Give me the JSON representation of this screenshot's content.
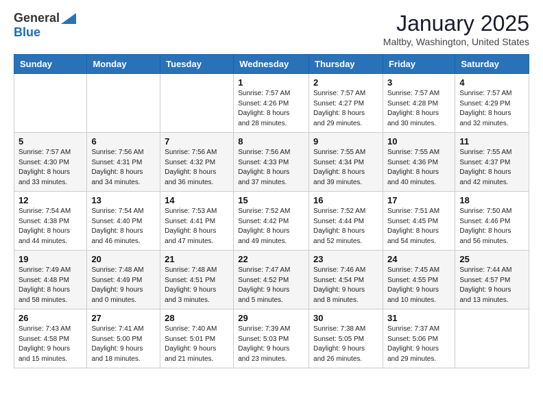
{
  "logo": {
    "general": "General",
    "blue": "Blue"
  },
  "header": {
    "month": "January 2025",
    "location": "Maltby, Washington, United States"
  },
  "weekdays": [
    "Sunday",
    "Monday",
    "Tuesday",
    "Wednesday",
    "Thursday",
    "Friday",
    "Saturday"
  ],
  "weeks": [
    [
      {
        "day": "",
        "info": ""
      },
      {
        "day": "",
        "info": ""
      },
      {
        "day": "",
        "info": ""
      },
      {
        "day": "1",
        "info": "Sunrise: 7:57 AM\nSunset: 4:26 PM\nDaylight: 8 hours\nand 28 minutes."
      },
      {
        "day": "2",
        "info": "Sunrise: 7:57 AM\nSunset: 4:27 PM\nDaylight: 8 hours\nand 29 minutes."
      },
      {
        "day": "3",
        "info": "Sunrise: 7:57 AM\nSunset: 4:28 PM\nDaylight: 8 hours\nand 30 minutes."
      },
      {
        "day": "4",
        "info": "Sunrise: 7:57 AM\nSunset: 4:29 PM\nDaylight: 8 hours\nand 32 minutes."
      }
    ],
    [
      {
        "day": "5",
        "info": "Sunrise: 7:57 AM\nSunset: 4:30 PM\nDaylight: 8 hours\nand 33 minutes."
      },
      {
        "day": "6",
        "info": "Sunrise: 7:56 AM\nSunset: 4:31 PM\nDaylight: 8 hours\nand 34 minutes."
      },
      {
        "day": "7",
        "info": "Sunrise: 7:56 AM\nSunset: 4:32 PM\nDaylight: 8 hours\nand 36 minutes."
      },
      {
        "day": "8",
        "info": "Sunrise: 7:56 AM\nSunset: 4:33 PM\nDaylight: 8 hours\nand 37 minutes."
      },
      {
        "day": "9",
        "info": "Sunrise: 7:55 AM\nSunset: 4:34 PM\nDaylight: 8 hours\nand 39 minutes."
      },
      {
        "day": "10",
        "info": "Sunrise: 7:55 AM\nSunset: 4:36 PM\nDaylight: 8 hours\nand 40 minutes."
      },
      {
        "day": "11",
        "info": "Sunrise: 7:55 AM\nSunset: 4:37 PM\nDaylight: 8 hours\nand 42 minutes."
      }
    ],
    [
      {
        "day": "12",
        "info": "Sunrise: 7:54 AM\nSunset: 4:38 PM\nDaylight: 8 hours\nand 44 minutes."
      },
      {
        "day": "13",
        "info": "Sunrise: 7:54 AM\nSunset: 4:40 PM\nDaylight: 8 hours\nand 46 minutes."
      },
      {
        "day": "14",
        "info": "Sunrise: 7:53 AM\nSunset: 4:41 PM\nDaylight: 8 hours\nand 47 minutes."
      },
      {
        "day": "15",
        "info": "Sunrise: 7:52 AM\nSunset: 4:42 PM\nDaylight: 8 hours\nand 49 minutes."
      },
      {
        "day": "16",
        "info": "Sunrise: 7:52 AM\nSunset: 4:44 PM\nDaylight: 8 hours\nand 52 minutes."
      },
      {
        "day": "17",
        "info": "Sunrise: 7:51 AM\nSunset: 4:45 PM\nDaylight: 8 hours\nand 54 minutes."
      },
      {
        "day": "18",
        "info": "Sunrise: 7:50 AM\nSunset: 4:46 PM\nDaylight: 8 hours\nand 56 minutes."
      }
    ],
    [
      {
        "day": "19",
        "info": "Sunrise: 7:49 AM\nSunset: 4:48 PM\nDaylight: 8 hours\nand 58 minutes."
      },
      {
        "day": "20",
        "info": "Sunrise: 7:48 AM\nSunset: 4:49 PM\nDaylight: 9 hours\nand 0 minutes."
      },
      {
        "day": "21",
        "info": "Sunrise: 7:48 AM\nSunset: 4:51 PM\nDaylight: 9 hours\nand 3 minutes."
      },
      {
        "day": "22",
        "info": "Sunrise: 7:47 AM\nSunset: 4:52 PM\nDaylight: 9 hours\nand 5 minutes."
      },
      {
        "day": "23",
        "info": "Sunrise: 7:46 AM\nSunset: 4:54 PM\nDaylight: 9 hours\nand 8 minutes."
      },
      {
        "day": "24",
        "info": "Sunrise: 7:45 AM\nSunset: 4:55 PM\nDaylight: 9 hours\nand 10 minutes."
      },
      {
        "day": "25",
        "info": "Sunrise: 7:44 AM\nSunset: 4:57 PM\nDaylight: 9 hours\nand 13 minutes."
      }
    ],
    [
      {
        "day": "26",
        "info": "Sunrise: 7:43 AM\nSunset: 4:58 PM\nDaylight: 9 hours\nand 15 minutes."
      },
      {
        "day": "27",
        "info": "Sunrise: 7:41 AM\nSunset: 5:00 PM\nDaylight: 9 hours\nand 18 minutes."
      },
      {
        "day": "28",
        "info": "Sunrise: 7:40 AM\nSunset: 5:01 PM\nDaylight: 9 hours\nand 21 minutes."
      },
      {
        "day": "29",
        "info": "Sunrise: 7:39 AM\nSunset: 5:03 PM\nDaylight: 9 hours\nand 23 minutes."
      },
      {
        "day": "30",
        "info": "Sunrise: 7:38 AM\nSunset: 5:05 PM\nDaylight: 9 hours\nand 26 minutes."
      },
      {
        "day": "31",
        "info": "Sunrise: 7:37 AM\nSunset: 5:06 PM\nDaylight: 9 hours\nand 29 minutes."
      },
      {
        "day": "",
        "info": ""
      }
    ]
  ]
}
